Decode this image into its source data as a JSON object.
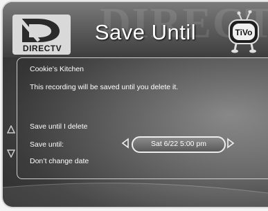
{
  "header": {
    "watermark": "DIRECTV",
    "logo_text": "DIRECTV",
    "title": "Save Until",
    "tivo_label": "TiVo"
  },
  "panel": {
    "show_title": "Cookie’s Kitchen",
    "info": "This recording will be saved until you delete it.",
    "options": {
      "save_until_delete": "Save until I delete",
      "save_until": "Save until:",
      "dont_change": "Don’t change date"
    },
    "date_value": "Sat  6/22  5:00 pm"
  },
  "icons": {
    "logo": "directv-logo-icon",
    "tivo": "tivo-mascot-icon",
    "left": "left-arrow-icon",
    "right": "right-arrow-icon",
    "up": "scroll-up-icon",
    "down": "scroll-down-icon"
  }
}
